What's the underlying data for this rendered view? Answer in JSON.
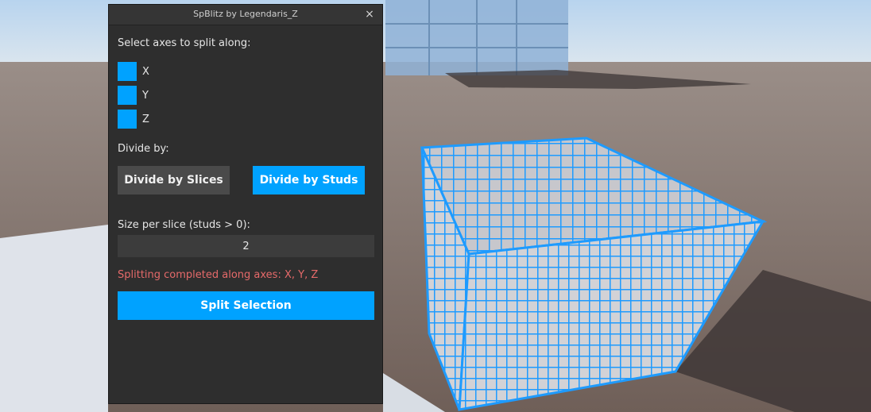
{
  "window": {
    "title": "SpBlitz by Legendaris_Z",
    "close_glyph": "×"
  },
  "axes": {
    "heading": "Select axes to split along:",
    "items": [
      {
        "label": "X",
        "checked": true
      },
      {
        "label": "Y",
        "checked": true
      },
      {
        "label": "Z",
        "checked": true
      }
    ]
  },
  "divide": {
    "heading": "Divide by:",
    "slices_label": "Divide by Slices",
    "studs_label": "Divide by Studs",
    "active": "studs"
  },
  "size": {
    "label": "Size per slice (studs > 0):",
    "value": "2"
  },
  "status": {
    "text": "Splitting completed along axes: X, Y, Z",
    "color": "#e66a6a"
  },
  "actions": {
    "split_label": "Split Selection"
  },
  "colors": {
    "accent": "#00a2ff",
    "panel_bg": "#2e2e2e",
    "inactive_button": "#4a4a4a"
  },
  "icons": {
    "close": "close-icon"
  }
}
